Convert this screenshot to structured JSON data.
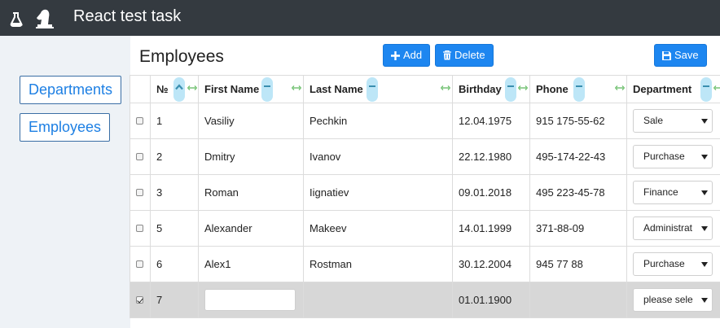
{
  "app": {
    "title": "React test task"
  },
  "sidebar": {
    "items": [
      {
        "label": "Departments"
      },
      {
        "label": "Employees"
      }
    ]
  },
  "page": {
    "title": "Employees"
  },
  "toolbar": {
    "add_label": "Add",
    "delete_label": "Delete",
    "save_label": "Save"
  },
  "table": {
    "columns": [
      "№",
      "First Name",
      "Last Name",
      "Birthday",
      "Phone",
      "Department"
    ],
    "rows": [
      {
        "checked": false,
        "num": "1",
        "first": "Vasiliy",
        "last": "Pechkin",
        "birthday": "12.04.1975",
        "phone": "915 175-55-62",
        "department": "Sale"
      },
      {
        "checked": false,
        "num": "2",
        "first": "Dmitry",
        "last": "Ivanov",
        "birthday": "22.12.1980",
        "phone": "495-174-22-43",
        "department": "Purchase"
      },
      {
        "checked": false,
        "num": "3",
        "first": "Roman",
        "last": "Iignatiev",
        "birthday": "09.01.2018",
        "phone": "495 223-45-78",
        "department": "Finance"
      },
      {
        "checked": false,
        "num": "5",
        "first": "Alexander",
        "last": "Makeev",
        "birthday": "14.01.1999",
        "phone": "371-88-09",
        "department": "Administrat"
      },
      {
        "checked": false,
        "num": "6",
        "first": "Alex1",
        "last": "Rostman",
        "birthday": "30.12.2004",
        "phone": "945 77 88",
        "department": "Purchase"
      },
      {
        "checked": true,
        "num": "7",
        "first": "",
        "last": "",
        "birthday": "01.01.1900",
        "phone": "",
        "department": "please sele"
      }
    ]
  },
  "colors": {
    "topbar": "#343a40",
    "primary": "#1d86f0",
    "sidebar_bg": "#eef2f6",
    "sort_pill": "#bde6f7",
    "resize_arrow": "#5cb85c",
    "selected_row": "#d7d7d7"
  },
  "icons": {
    "brand": [
      "flask-icon",
      "chess-knight-icon"
    ],
    "add": "plus-icon",
    "delete": "trash-icon",
    "save": "floppy-disk-icon"
  }
}
